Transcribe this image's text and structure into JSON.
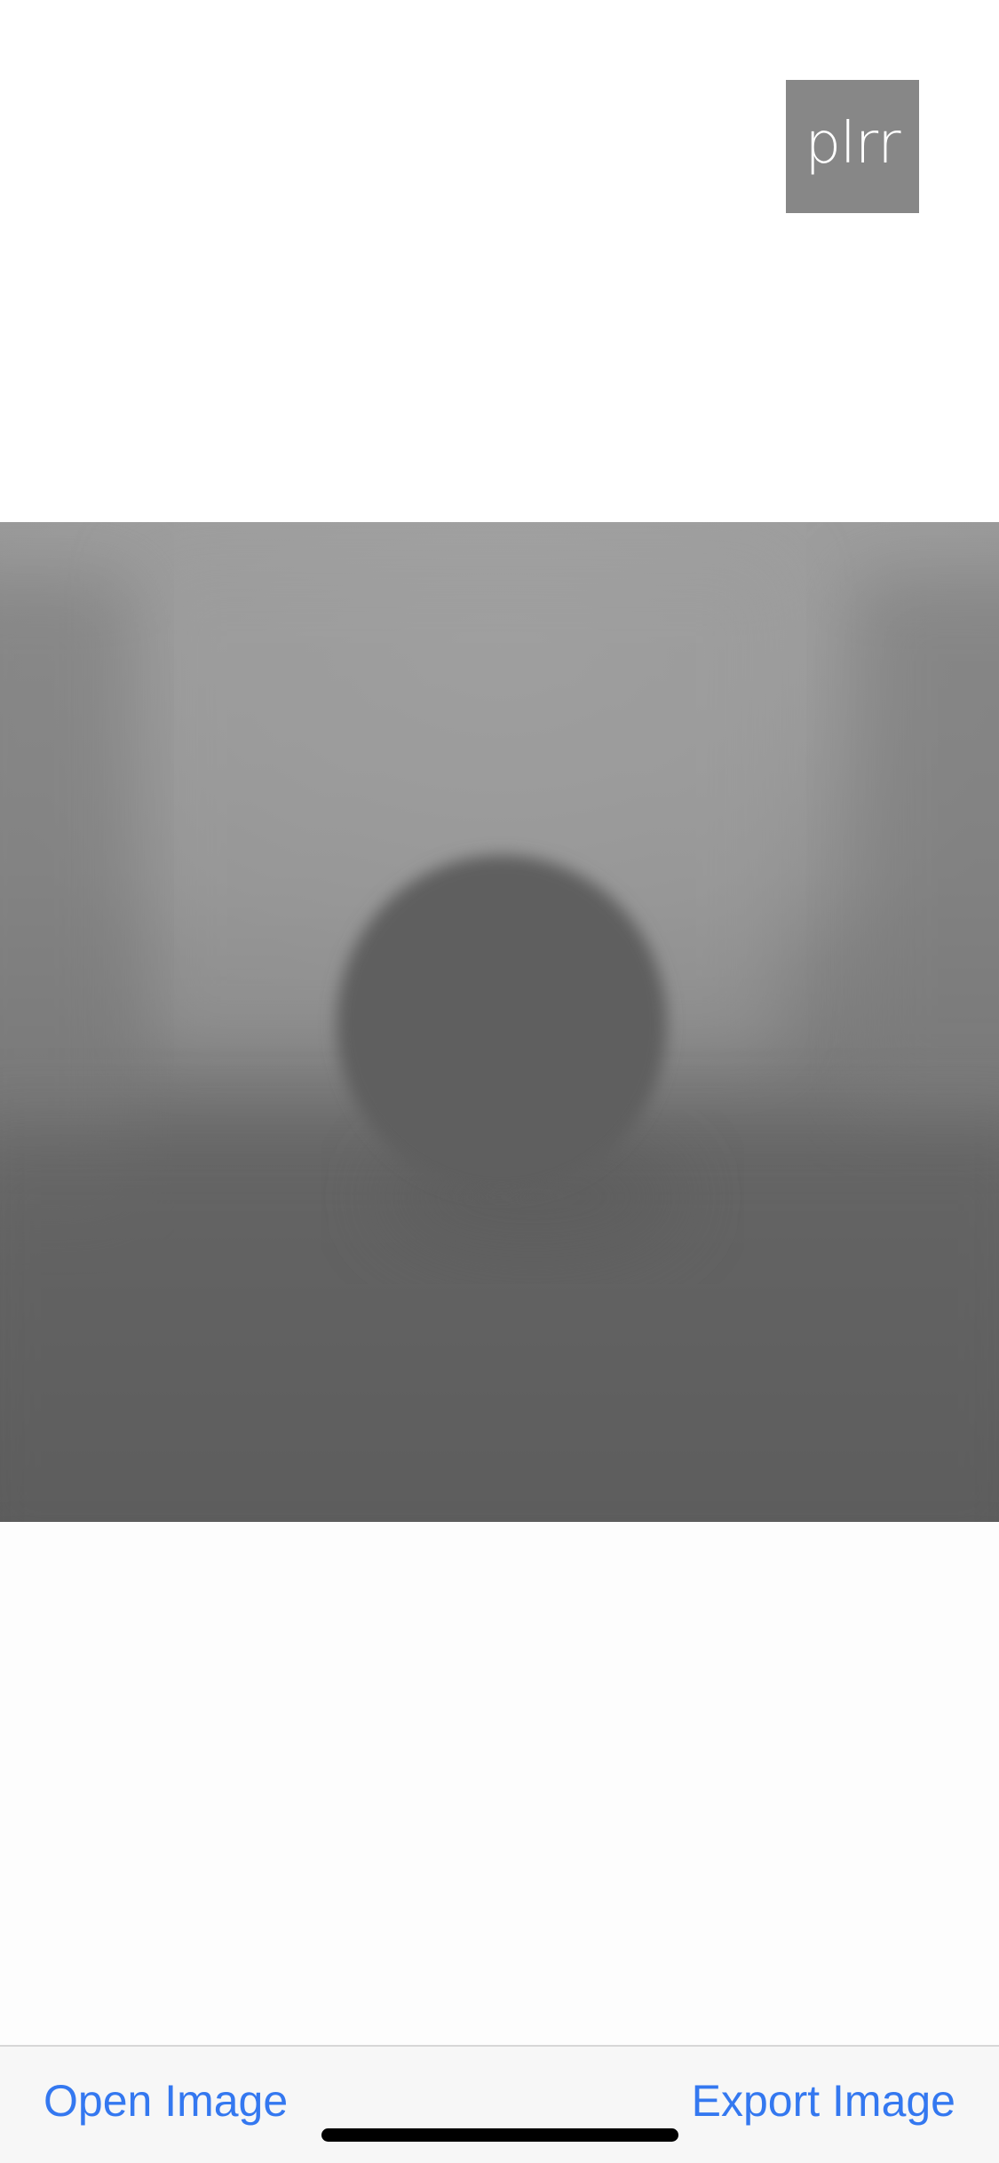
{
  "app": {
    "logo_text": "plrr",
    "logo_color": "#878787"
  },
  "image_view": {
    "description_icon": "blurred-photo"
  },
  "toolbar": {
    "open_label": "Open Image",
    "export_label": "Export Image",
    "accent_color": "#3478f0"
  }
}
